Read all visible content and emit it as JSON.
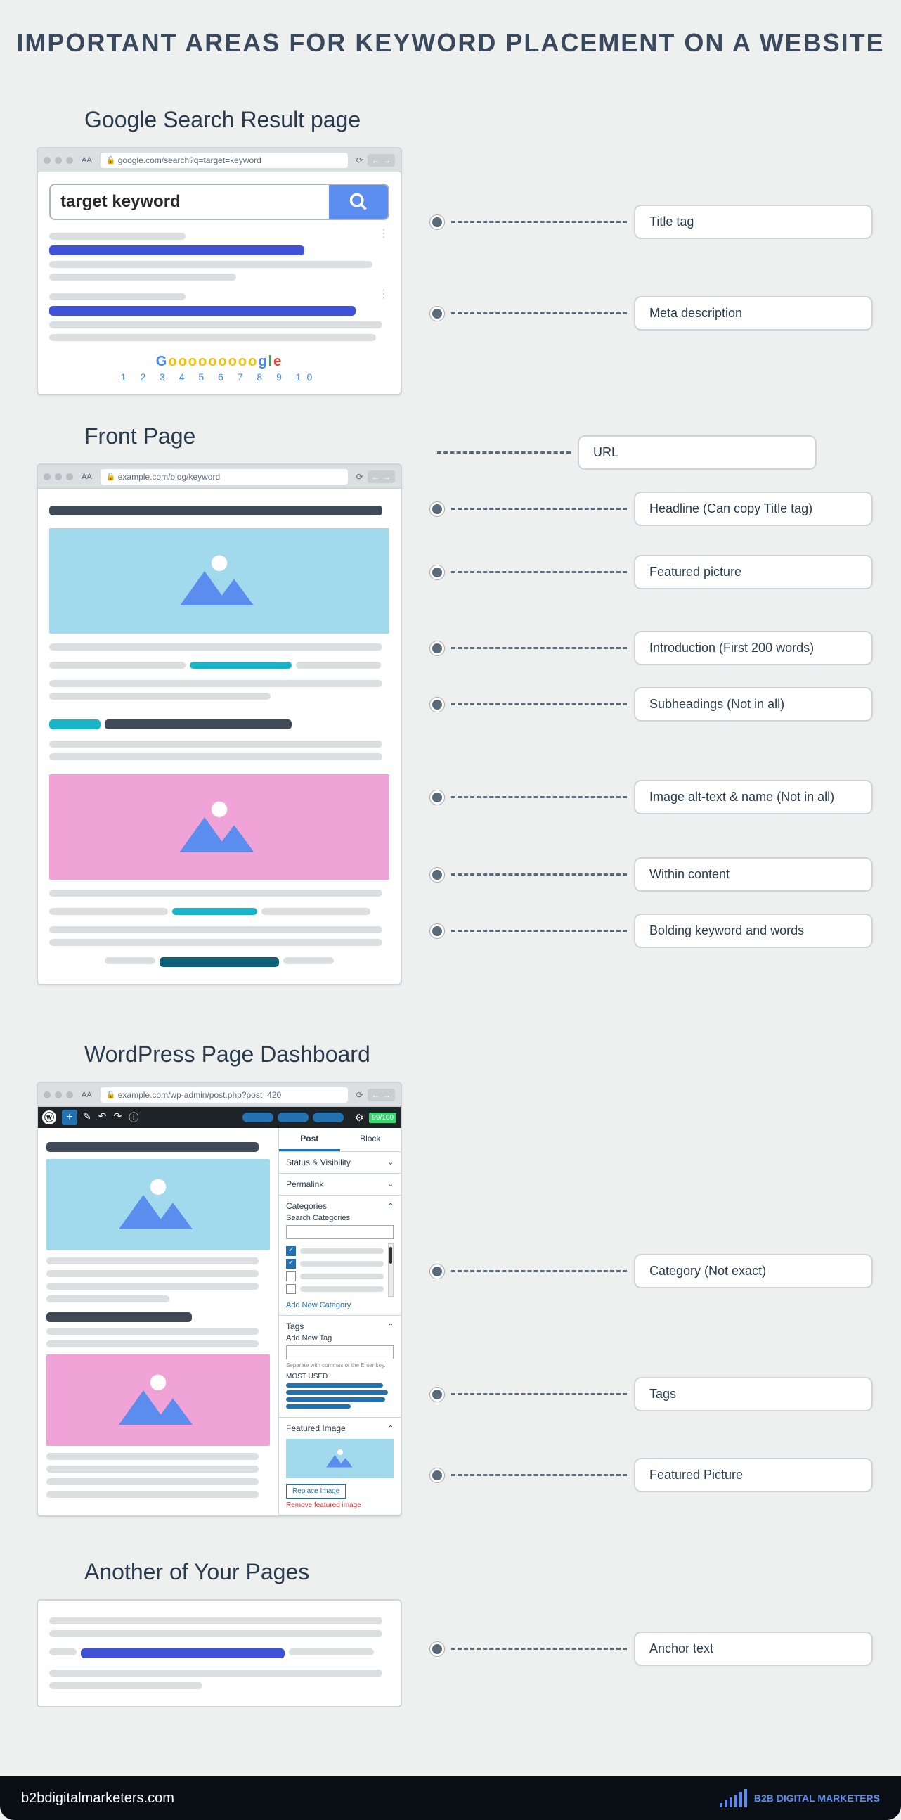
{
  "title": "IMPORTANT AREAS FOR KEYWORD PLACEMENT ON A WEBSITE",
  "sections": {
    "serp": {
      "heading": "Google Search Result page",
      "url": "google.com/search?q=target=keyword",
      "search_value": "target keyword",
      "pagination_letters": "Goooooooooogle",
      "pagination_numbers": "1 2 3 4 5 6 7 8 9 10",
      "callouts": [
        "Title tag",
        "Meta description"
      ]
    },
    "front": {
      "heading": "Front Page",
      "url": "example.com/blog/keyword",
      "callouts": [
        "URL",
        "Headline (Can copy Title tag)",
        "Featured picture",
        "Introduction (First 200 words)",
        "Subheadings (Not in all)",
        "Image alt-text & name (Not in all)",
        "Within content",
        "Bolding keyword and words"
      ]
    },
    "wp": {
      "heading": "WordPress Page Dashboard",
      "url": "example.com/wp-admin/post.php?post=420",
      "score": "99/100",
      "panel": {
        "tab_post": "Post",
        "tab_block": "Block",
        "status": "Status & Visibility",
        "permalink": "Permalink",
        "categories": "Categories",
        "search_cat": "Search Categories",
        "add_cat": "Add New Category",
        "tags": "Tags",
        "add_tag": "Add New Tag",
        "tag_hint": "Separate with commas or the Enter key.",
        "most_used": "MOST USED",
        "featured": "Featured Image",
        "replace": "Replace Image",
        "remove": "Remove featured image"
      },
      "callouts": [
        "Category (Not exact)",
        "Tags",
        "Featured Picture"
      ]
    },
    "another": {
      "heading": "Another of Your Pages",
      "callouts": [
        "Anchor text"
      ]
    }
  },
  "footer": {
    "site": "b2bdigitalmarketers.com",
    "brand": "B2B DIGITAL MARKETERS"
  }
}
